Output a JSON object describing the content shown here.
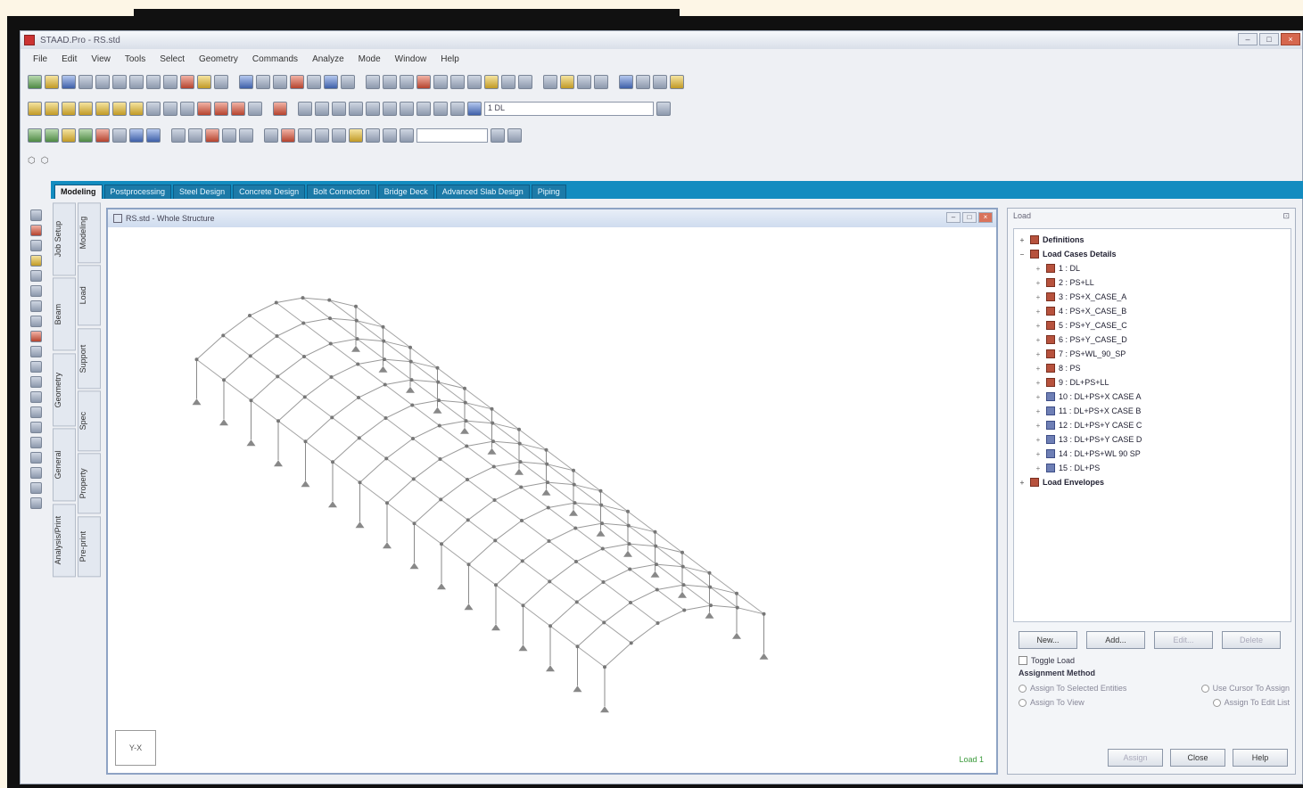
{
  "window": {
    "title": "STAAD.Pro - RS.std"
  },
  "menu": [
    "File",
    "Edit",
    "View",
    "Tools",
    "Select",
    "Geometry",
    "Commands",
    "Analyze",
    "Mode",
    "Window",
    "Help"
  ],
  "toolbar": {
    "load_select": "1 DL"
  },
  "tabs": [
    "Modeling",
    "Postprocessing",
    "Steel Design",
    "Concrete Design",
    "Bolt Connection",
    "Bridge Deck",
    "Advanced Slab Design",
    "Piping"
  ],
  "vertical_tabs": {
    "left": [
      "Job Setup",
      "Beam",
      "Geometry",
      "General",
      "Analysis/Print"
    ],
    "right": [
      "Modeling",
      "Load",
      "Support",
      "Spec",
      "Property",
      "Pre-print"
    ]
  },
  "viewport": {
    "title": "RS.std - Whole Structure",
    "axis_label": "Y-X",
    "status": "Load 1"
  },
  "load_panel": {
    "title": "Load",
    "tree": {
      "definitions": "Definitions",
      "load_case_details": "Load Cases Details",
      "cases": [
        "1 : DL",
        "2 : PS+LL",
        "3 : PS+X_CASE_A",
        "4 : PS+X_CASE_B",
        "5 : PS+Y_CASE_C",
        "6 : PS+Y_CASE_D",
        "7 : PS+WL_90_SP",
        "8 : PS",
        "9 : DL+PS+LL",
        "10 : DL+PS+X CASE A",
        "11 : DL+PS+X CASE B",
        "12 : DL+PS+Y CASE C",
        "13 : DL+PS+Y CASE D",
        "14 : DL+PS+WL 90 SP",
        "15 : DL+PS"
      ],
      "load_envelopes": "Load Envelopes"
    },
    "buttons": {
      "new": "New...",
      "add": "Add...",
      "edit": "Edit...",
      "delete": "Delete"
    },
    "toggle_load": "Toggle Load",
    "assignment_method": "Assignment Method",
    "assign_options": {
      "selected": "Assign To Selected Entities",
      "view": "Assign To View",
      "use_cursor": "Use Cursor To Assign",
      "edit_list": "Assign To Edit List"
    },
    "bottom_buttons": {
      "assign": "Assign",
      "close": "Close",
      "help": "Help"
    }
  },
  "colors": {
    "tab_strip": "#138cc0",
    "status_green": "#3a9a3a",
    "close_red": "#d6674f"
  }
}
